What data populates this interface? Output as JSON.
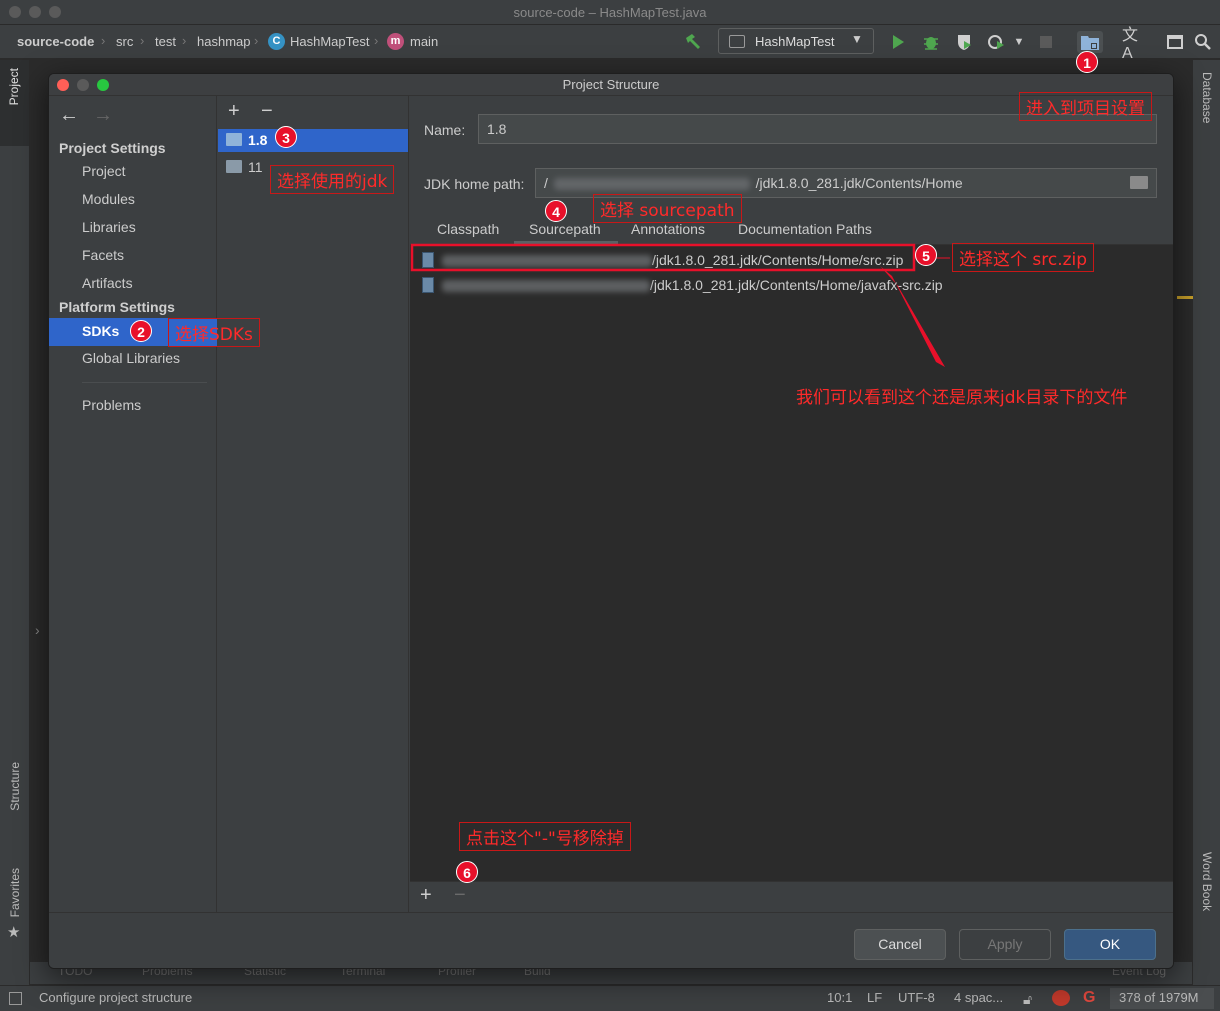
{
  "window": {
    "title": "source-code – HashMapTest.java"
  },
  "breadcrumbs": [
    "source-code",
    "src",
    "test",
    "hashmap",
    "HashMapTest",
    "main"
  ],
  "toolbar": {
    "run_config": "HashMapTest"
  },
  "left_tabs": {
    "project": "Project",
    "structure": "Structure",
    "favorites": "Favorites"
  },
  "right_tabs": {
    "database": "Database",
    "word_book": "Word Book"
  },
  "bottom_tools": [
    "TODO",
    "Problems",
    "Statistic",
    "Terminal",
    "Profiler",
    "Build",
    "Event Log"
  ],
  "statusbar": {
    "message": "Configure project structure",
    "position": "10:1",
    "line_sep": "LF",
    "encoding": "UTF-8",
    "indent": "4 spac...",
    "memory": "378 of 1979M"
  },
  "dialog": {
    "title": "Project Structure",
    "nav": {
      "project_settings": "Project Settings",
      "project_items": [
        "Project",
        "Modules",
        "Libraries",
        "Facets",
        "Artifacts"
      ],
      "platform_settings": "Platform Settings",
      "platform_items": [
        "SDKs",
        "Global Libraries"
      ],
      "problems": "Problems",
      "selected": "SDKs"
    },
    "sdk_list": {
      "add": "+",
      "remove": "−",
      "items": [
        "1.8",
        "11"
      ],
      "selected": "1.8"
    },
    "main": {
      "name_label": "Name:",
      "name_value": "1.8",
      "jdk_home_label": "JDK home path:",
      "jdk_home_prefix": "/",
      "jdk_home_suffix": "/jdk1.8.0_281.jdk/Contents/Home",
      "tabs": [
        "Classpath",
        "Sourcepath",
        "Annotations",
        "Documentation Paths"
      ],
      "active_tab": "Sourcepath",
      "paths": [
        "/jdk1.8.0_281.jdk/Contents/Home/src.zip",
        "/jdk1.8.0_281.jdk/Contents/Home/javafx-src.zip"
      ],
      "add": "+",
      "remove": "−"
    },
    "buttons": {
      "cancel": "Cancel",
      "apply": "Apply",
      "ok": "OK"
    }
  },
  "annotations": {
    "badges": [
      "1",
      "2",
      "3",
      "4",
      "5",
      "6"
    ],
    "notes": {
      "n1": "进入到项目设置",
      "n2": "选择SDKs",
      "n3": "选择使用的jdk",
      "n4": "选择 sourcepath",
      "n5": "选择这个 src.zip",
      "n_arrow": "我们可以看到这个还是原来jdk目录下的文件",
      "n6": "点击这个\"-\"号移除掉"
    }
  },
  "colors": {
    "selection": "#2f65ca",
    "annotation": "#e8102a",
    "ok_button": "#365880",
    "run_green": "#4fa64f"
  }
}
